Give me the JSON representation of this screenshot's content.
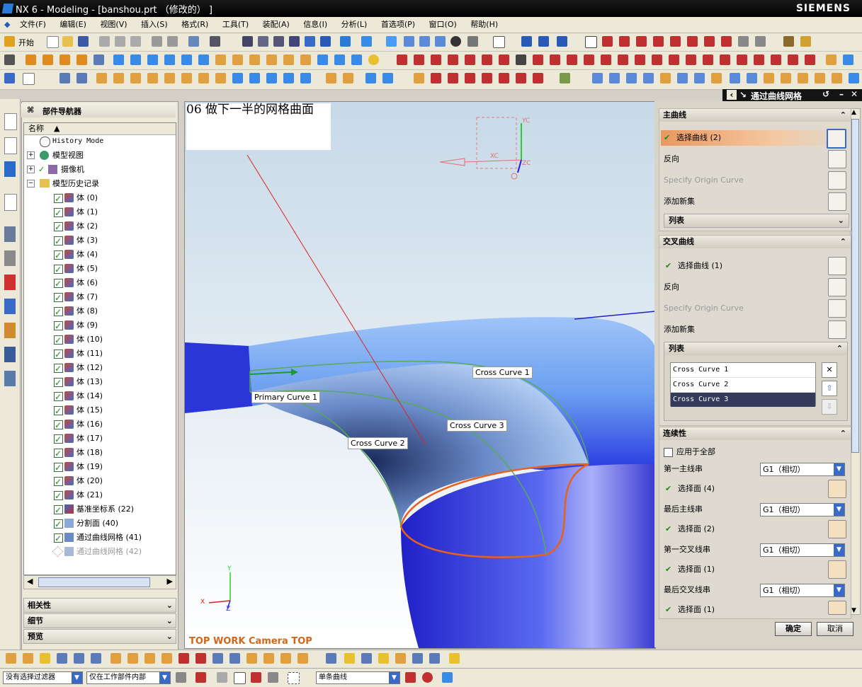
{
  "window": {
    "title": "NX 6 - Modeling - [banshou.prt （修改的） ]",
    "brand": "SIEMENS"
  },
  "menu": [
    "文件(F)",
    "编辑(E)",
    "视图(V)",
    "插入(S)",
    "格式(R)",
    "工具(T)",
    "装配(A)",
    "信息(I)",
    "分析(L)",
    "首选项(P)",
    "窗口(O)",
    "帮助(H)"
  ],
  "toolbar": {
    "start_label": "开始"
  },
  "navigator": {
    "title": "部件导航器",
    "column": "名称",
    "history_mode": "History Mode",
    "model_views": "模型视图",
    "cameras": "摄像机",
    "model_history": "模型历史记录",
    "items": [
      "体 (0)",
      "体 (1)",
      "体 (2)",
      "体 (3)",
      "体 (4)",
      "体 (5)",
      "体 (6)",
      "体 (7)",
      "体 (8)",
      "体 (9)",
      "体 (10)",
      "体 (11)",
      "体 (12)",
      "体 (13)",
      "体 (14)",
      "体 (15)",
      "体 (16)",
      "体 (17)",
      "体 (18)",
      "体 (19)",
      "体 (20)",
      "体 (21)",
      "基准坐标系 (22)",
      "分割面 (40)",
      "通过曲线网格 (41)",
      "通过曲线网格 (42)"
    ],
    "sections": [
      "相关性",
      "细节",
      "预览"
    ]
  },
  "viewport": {
    "note": "06 做下一半的网格曲面",
    "footer": "TOP WORK Camera TOP",
    "labels": {
      "cc1": "Cross Curve 1",
      "cc2": "Cross Curve 2",
      "cc3": "Cross Curve 3",
      "pc1": "Primary Curve 1"
    },
    "axes": {
      "xc": "XC",
      "yc": "YC",
      "zc": "ZC",
      "x": "X",
      "y": "Y",
      "z": "Z"
    }
  },
  "dialog": {
    "title": "通过曲线网格",
    "primary": {
      "header": "主曲线",
      "select": "选择曲线 (2)",
      "reverse": "反向",
      "origin": "Specify Origin Curve",
      "add": "添加新集",
      "list": "列表"
    },
    "cross": {
      "header": "交叉曲线",
      "select": "选择曲线 (1)",
      "reverse": "反向",
      "origin": "Specify Origin Curve",
      "add": "添加新集",
      "list": "列表",
      "rows": [
        "Cross Curve  1",
        "Cross Curve  2",
        "Cross Curve  3"
      ]
    },
    "continuity": {
      "header": "连续性",
      "apply_all": "应用于全部",
      "first_primary": "第一主线串",
      "fp_value": "G1（相切）",
      "fp_sel": "选择面 (4)",
      "last_primary": "最后主线串",
      "lp_value": "G1（相切）",
      "lp_sel": "选择面 (2)",
      "first_cross": "第一交叉线串",
      "fc_value": "G1（相切）",
      "fc_sel": "选择面 (1)",
      "last_cross": "最后交叉线串",
      "lc_value": "G1（相切）",
      "lc_sel": "选择面 (1)"
    },
    "ok": "确定",
    "cancel": "取消"
  },
  "status": {
    "filter": "没有选择过滤器",
    "scope": "仅在工作部件内部",
    "curve_rule": "单条曲线"
  }
}
